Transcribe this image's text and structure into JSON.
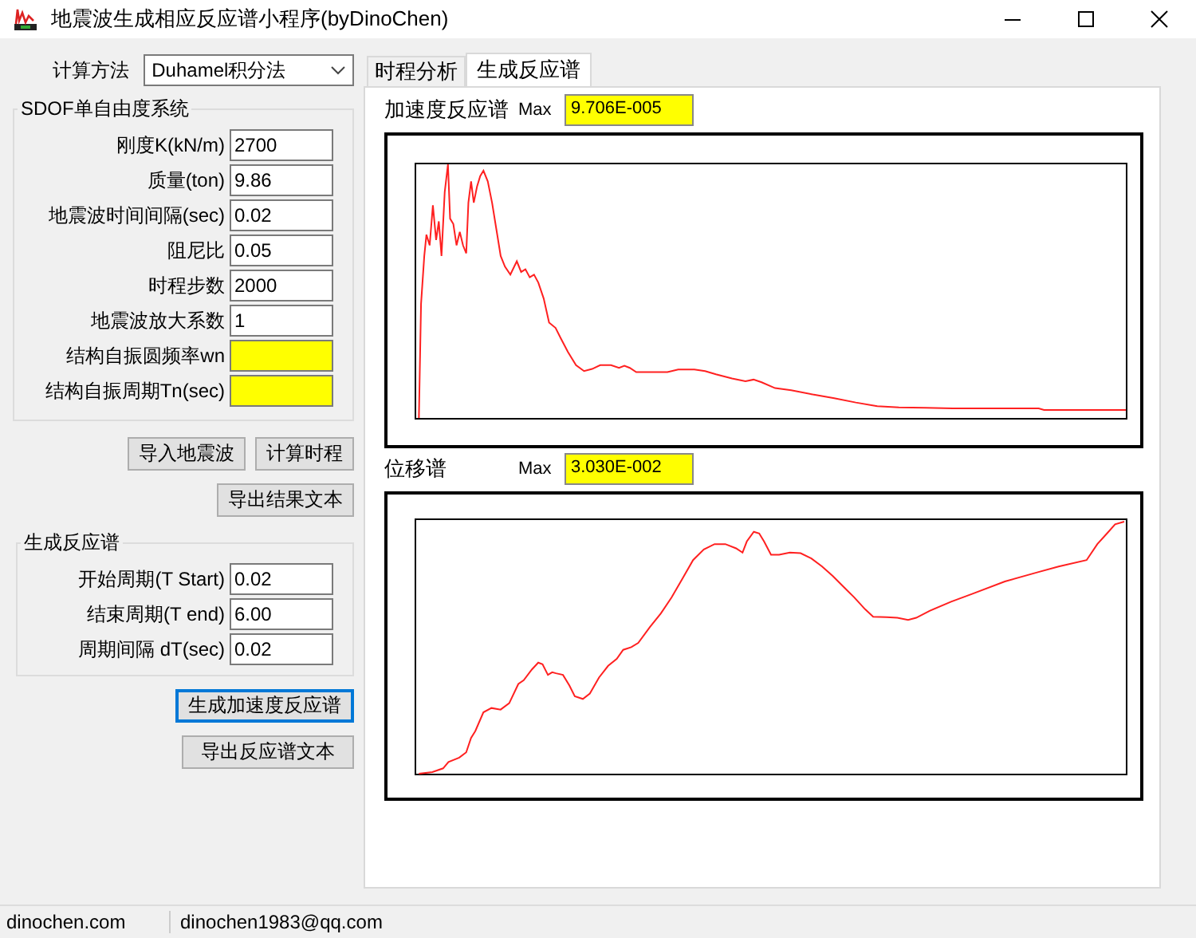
{
  "window": {
    "title": "地震波生成相应反应谱小程序(byDinoChen)"
  },
  "method": {
    "label": "计算方法",
    "value": "Duhamel积分法"
  },
  "sdof_group": {
    "legend": "SDOF单自由度系统",
    "fields": [
      {
        "label": "刚度K(kN/m)",
        "value": "2700",
        "highlighted": false
      },
      {
        "label": "质量(ton)",
        "value": "9.86",
        "highlighted": false
      },
      {
        "label": "地震波时间间隔(sec)",
        "value": "0.02",
        "highlighted": false
      },
      {
        "label": "阻尼比",
        "value": "0.05",
        "highlighted": false
      },
      {
        "label": "时程步数",
        "value": "2000",
        "highlighted": false
      },
      {
        "label": "地震波放大系数",
        "value": "1",
        "highlighted": false
      },
      {
        "label": "结构自振圆频率wn",
        "highlighted": true
      },
      {
        "label": "结构自振周期Tn(sec)",
        "highlighted": true
      }
    ]
  },
  "sdof_buttons": [
    {
      "label": "导入地震波",
      "focused": false
    },
    {
      "label": "计算时程",
      "focused": false
    },
    {
      "label": "导出结果文本",
      "focused": false
    }
  ],
  "spectrum_group": {
    "legend": "生成反应谱",
    "fields": [
      {
        "label": "开始周期(T Start)",
        "value": "0.02",
        "highlighted": false
      },
      {
        "label": "结束周期(T end)",
        "value": "6.00",
        "highlighted": false
      },
      {
        "label": "周期间隔 dT(sec)",
        "value": "0.02",
        "highlighted": false
      }
    ]
  },
  "spectrum_buttons": [
    {
      "label": "生成加速度反应谱",
      "focused": true
    },
    {
      "label": "导出反应谱文本",
      "focused": false
    }
  ],
  "tabs": [
    {
      "label": "时程分析",
      "selected": false
    },
    {
      "label": "生成反应谱",
      "selected": true
    }
  ],
  "charts": [
    {
      "kind": "acceleration",
      "title": "加速度反应谱",
      "max_label": "Max",
      "max_value": "9.706E-005"
    },
    {
      "kind": "displacement",
      "title": "位移谱",
      "max_label": "Max",
      "max_value": "3.030E-002"
    }
  ],
  "status_bar": [
    "dinochen.com",
    "dinochen1983@qq.com"
  ]
}
